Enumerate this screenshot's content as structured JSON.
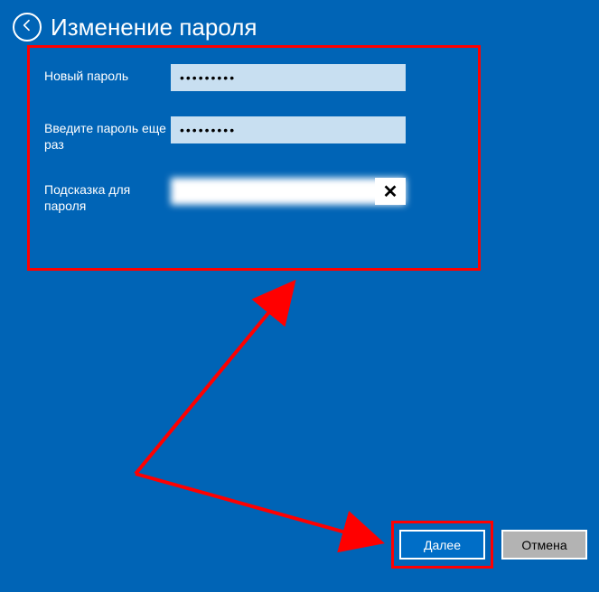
{
  "header": {
    "title": "Изменение пароля"
  },
  "form": {
    "new_password": {
      "label": "Новый пароль",
      "value": "•••••••••"
    },
    "confirm_password": {
      "label": "Введите пароль еще раз",
      "value": "•••••••••"
    },
    "hint": {
      "label": "Подсказка для пароля",
      "value": ""
    }
  },
  "buttons": {
    "next": "Далее",
    "cancel": "Отмена"
  },
  "icons": {
    "clear": "✕"
  }
}
